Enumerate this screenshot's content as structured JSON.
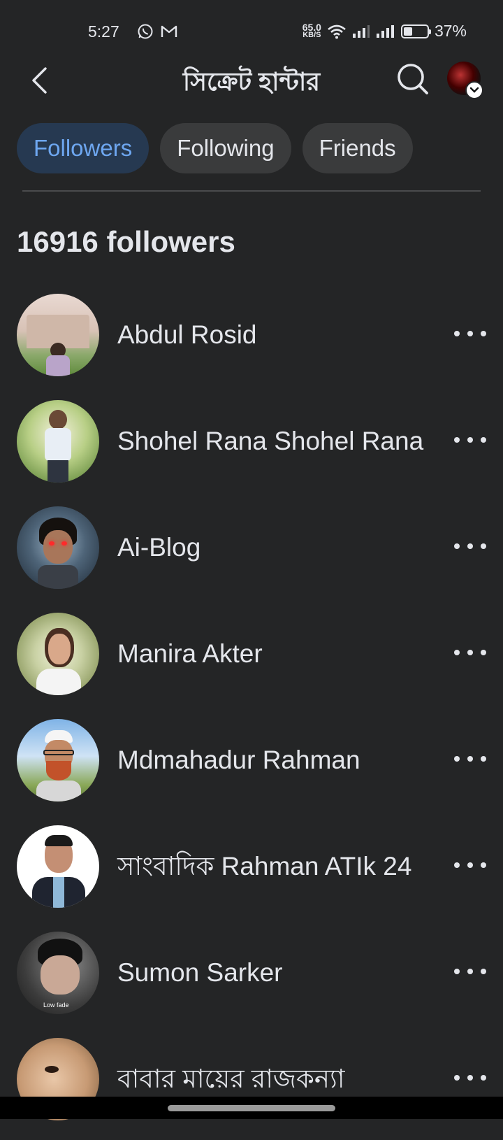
{
  "status_bar": {
    "time": "5:27",
    "net_speed_value": "65.0",
    "net_speed_unit": "KB/S",
    "battery": "37%",
    "battery_level": 0.37,
    "icons": [
      "whatsapp-icon",
      "gmail-icon",
      "wifi-icon",
      "signal-icon",
      "signal-icon",
      "battery-icon"
    ]
  },
  "header": {
    "title": "সিক্রেট হান্টার",
    "back_icon": "back-arrow-icon",
    "search_icon": "search-icon"
  },
  "tabs": [
    {
      "label": "Followers",
      "active": true
    },
    {
      "label": "Following",
      "active": false
    },
    {
      "label": "Friends",
      "active": false
    }
  ],
  "count_title": "16916 followers",
  "followers": [
    {
      "name": "Abdul Rosid"
    },
    {
      "name": "Shohel Rana Shohel Rana"
    },
    {
      "name": "Ai-Blog"
    },
    {
      "name": "Manira Akter"
    },
    {
      "name": "Mdmahadur Rahman"
    },
    {
      "name": "সাংবাদিক Rahman ATIk 24"
    },
    {
      "name": "Sumon Sarker",
      "avatar_text": "Low fade"
    },
    {
      "name": "বাবার মায়ের রাজকন্যা"
    }
  ],
  "colors": {
    "background": "#242526",
    "active_tab_bg": "#263951",
    "active_tab_text": "#6ea7f0",
    "tab_bg": "#3a3b3c"
  }
}
